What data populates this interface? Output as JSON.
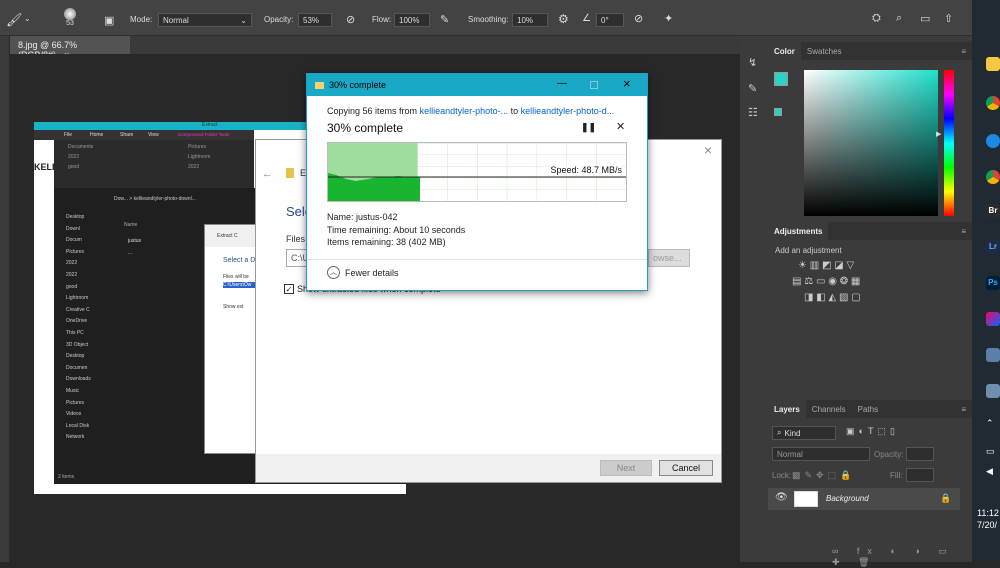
{
  "photoshop": {
    "options": {
      "brush_size": "53",
      "mode_label": "Mode:",
      "mode_value": "Normal",
      "opacity_label": "Opacity:",
      "opacity_value": "53%",
      "flow_label": "Flow:",
      "flow_value": "100%",
      "smoothing_label": "Smoothing:",
      "smoothing_value": "10%",
      "angle_value": "0°"
    },
    "doc_tab": "8.jpg @ 66.7% (RGB/8#)",
    "color_panel": {
      "tabs": [
        "Color",
        "Swatches"
      ],
      "fg_color": "#2ad1c6",
      "bg_color": "#ffffff"
    },
    "adjustments_panel": {
      "title": "Adjustments",
      "hint": "Add an adjustment"
    },
    "layers_panel": {
      "tabs": [
        "Layers",
        "Channels",
        "Paths"
      ],
      "filter_kind": "Kind",
      "blend_mode": "Normal",
      "opacity_label": "Opacity:",
      "lock_label": "Lock:",
      "fill_label": "Fill:",
      "layer_name": "Background"
    }
  },
  "background_window": {
    "ribbon_tabs": [
      "File",
      "Home",
      "Share",
      "View",
      "Compressed Folder Tools"
    ],
    "extract_label": "Extract",
    "brand_fragment": "KELLI",
    "path": "Dow... > kellieandtyler-photo-downl...",
    "sidebar": [
      "Desktop",
      "Downl",
      "Docum",
      "Pictures",
      "2022",
      "2022",
      "good",
      "Lightroom",
      "Creative C",
      "OneDrive",
      "This PC",
      "3D Object",
      "Desktop",
      "Documen",
      "Downloads",
      "Music",
      "Pictures",
      "Videos",
      "Local Disk",
      "Network"
    ],
    "files_header": "Name",
    "files": [
      "justus",
      "..."
    ],
    "status": "2 items",
    "quick_access": [
      "Documents",
      "2022",
      "good",
      "Pictures",
      "Lightroom",
      "2022"
    ],
    "inner_dialog": {
      "title": "Extract C",
      "heading": "Select a D",
      "files_label": "Files will be",
      "path_value": "C:\\Users\\Ow",
      "checkbox": "Show ext"
    }
  },
  "extract_dialog": {
    "heading": "Sele",
    "files_label": "Files w",
    "path_value": "C:\\U",
    "browse_label": "owse...",
    "checkbox_label": "Show extracted files when complete",
    "next_label": "Next",
    "cancel_label": "Cancel",
    "title_fragment": "Ex"
  },
  "copy_dialog": {
    "title": "30% complete",
    "copying_prefix": "Copying 56 items from",
    "source": "kellieandtyler-photo-...",
    "to_word": "to",
    "destination": "kellieandtyler-photo-d...",
    "progress_heading": "30% complete",
    "progress_percent": 30,
    "speed": "Speed: 48.7 MB/s",
    "name_label": "Name:",
    "name_value": "justus-042",
    "time_label": "Time remaining:",
    "time_value": "About 10 seconds",
    "items_label": "Items remaining:",
    "items_value": "38 (402 MB)",
    "fewer_details": "Fewer details"
  },
  "taskbar": {
    "time": "11:12",
    "date": "7/20/"
  }
}
